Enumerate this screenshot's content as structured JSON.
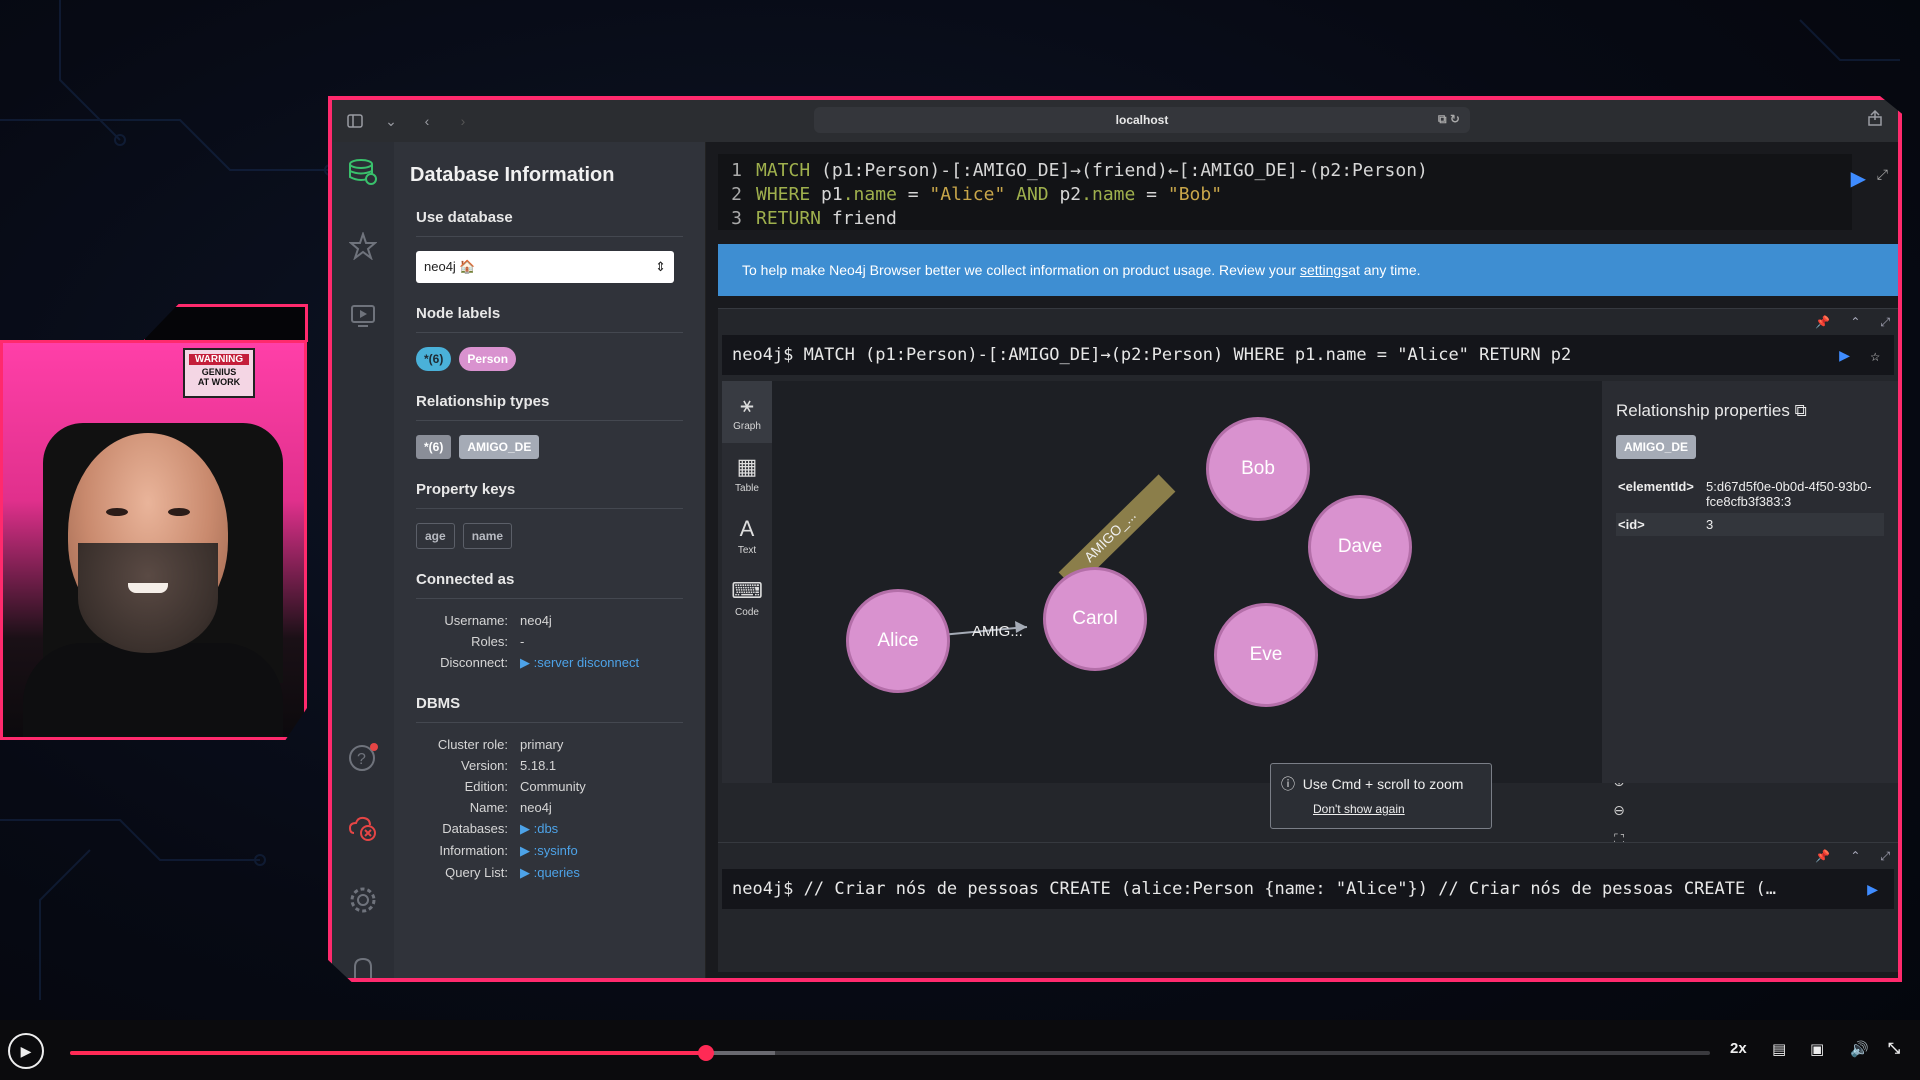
{
  "browser": {
    "url": "localhost"
  },
  "drawer": {
    "title": "Database Information",
    "use_database_heading": "Use database",
    "database_selected": "neo4j 🏠",
    "node_labels_heading": "Node labels",
    "node_labels": [
      "*(6)",
      "Person"
    ],
    "rel_types_heading": "Relationship types",
    "rel_types": [
      "*(6)",
      "AMIGO_DE"
    ],
    "property_keys_heading": "Property keys",
    "property_keys": [
      "age",
      "name"
    ],
    "connected_heading": "Connected as",
    "connected": [
      {
        "k": "Username:",
        "v": "neo4j"
      },
      {
        "k": "Roles:",
        "v": "-"
      },
      {
        "k": "Disconnect:",
        "v": ":server disconnect"
      }
    ],
    "dbms_heading": "DBMS",
    "dbms": [
      {
        "k": "Cluster role:",
        "v": "primary"
      },
      {
        "k": "Version:",
        "v": "5.18.1"
      },
      {
        "k": "Edition:",
        "v": "Community"
      },
      {
        "k": "Name:",
        "v": "neo4j"
      },
      {
        "k": "Databases:",
        "v": ":dbs"
      },
      {
        "k": "Information:",
        "v": ":sysinfo"
      },
      {
        "k": "Query List:",
        "v": ":queries"
      }
    ]
  },
  "editor": {
    "lines": [
      {
        "n": "1",
        "parts": [
          [
            "kw",
            "MATCH "
          ],
          [
            "pl",
            "(p1:Person)-[:AMIGO_DE]→(friend)←[:AMIGO_DE]-(p2:Person)"
          ]
        ]
      },
      {
        "n": "2",
        "parts": [
          [
            "kw",
            "WHERE "
          ],
          [
            "pl",
            "p1"
          ],
          [
            "kw",
            ".name"
          ],
          [
            "pl",
            " = "
          ],
          [
            "str",
            "\"Alice\""
          ],
          [
            "kw",
            " AND "
          ],
          [
            "pl",
            "p2"
          ],
          [
            "kw",
            ".name"
          ],
          [
            "pl",
            " = "
          ],
          [
            "str",
            "\"Bob\""
          ]
        ]
      },
      {
        "n": "3",
        "parts": [
          [
            "kw",
            "RETURN "
          ],
          [
            "pl",
            "friend"
          ]
        ]
      }
    ]
  },
  "banner": {
    "text_before": "To help make Neo4j Browser better we collect information on product usage. Review your ",
    "link": "settings",
    "text_after": " at any time."
  },
  "frame1": {
    "query": "neo4j$ MATCH (p1:Person)-[:AMIGO_DE]→(p2:Person) WHERE p1.name = \"Alice\" RETURN p2",
    "tabs": [
      "Graph",
      "Table",
      "Text",
      "Code"
    ],
    "nodes": [
      "Bob",
      "Dave",
      "Alice",
      "Carol",
      "Eve"
    ],
    "edge_label_1": "AMIG...",
    "edge_label_2": "AMIGO_...",
    "tooltip_text": "Use Cmd + scroll to zoom",
    "tooltip_link": "Don't show again",
    "props_title": "Relationship properties",
    "props_rel": "AMIGO_DE",
    "props": [
      {
        "k": "<elementId>",
        "v": "5:d67d5f0e-0b0d-4f50-93b0-fce8cfb3f383:3"
      },
      {
        "k": "<id>",
        "v": "3"
      }
    ]
  },
  "frame2": {
    "query": "neo4j$ // Criar nós de pessoas CREATE (alice:Person {name: \"Alice\"}) // Criar nós de pessoas CREATE (…"
  },
  "player": {
    "speed": "2x",
    "progress": 0.388,
    "buffered": 0.43
  },
  "webcam": {
    "sign_line1": "WARNING",
    "sign_line2": "GENIUS",
    "sign_line3": "AT WORK"
  }
}
